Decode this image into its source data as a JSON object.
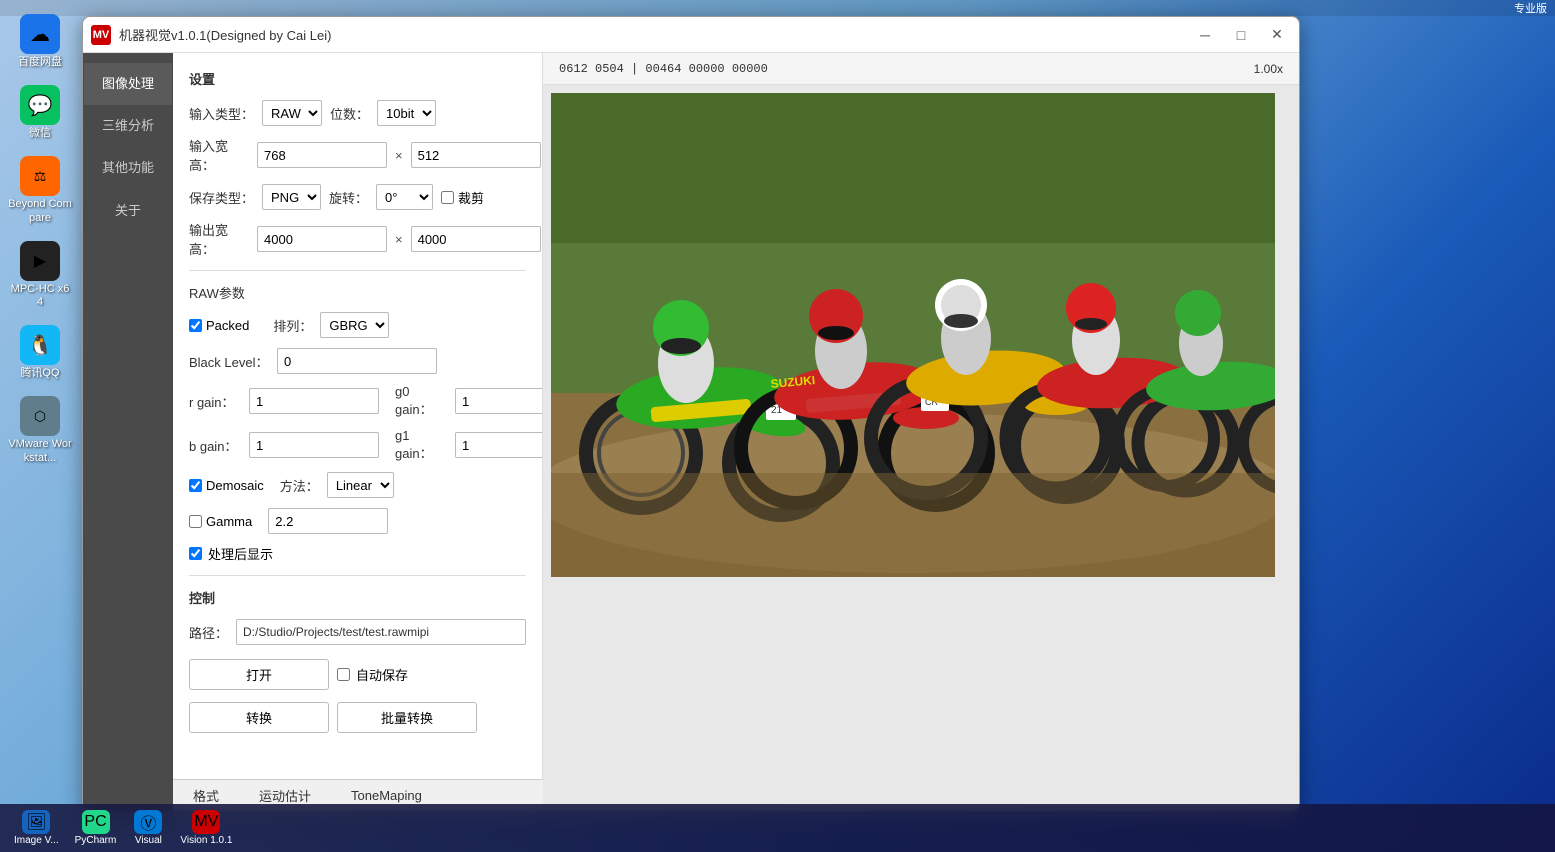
{
  "app": {
    "title": "机器视觉v1.0.1(Designed by Cai Lei)",
    "icon_label": "MV",
    "top_bar_text": "专业版"
  },
  "title_controls": {
    "minimize": "─",
    "maximize": "□",
    "close": "✕"
  },
  "image_info": {
    "coords": "0612 0504 | 00464 00000 00000",
    "zoom": "1.00x"
  },
  "sidebar": {
    "items": [
      {
        "id": "image-processing",
        "label": "图像处理",
        "active": true
      },
      {
        "id": "3d-analysis",
        "label": "三维分析",
        "active": false
      },
      {
        "id": "other-functions",
        "label": "其他功能",
        "active": false
      },
      {
        "id": "about",
        "label": "关于",
        "active": false
      }
    ]
  },
  "settings": {
    "section_title": "设置",
    "input_type_label": "输入类型：",
    "input_type_value": "RAW",
    "bit_depth_label": "位数：",
    "bit_depth_value": "10bit",
    "input_width_label": "输入宽高：",
    "input_width_value": "768",
    "input_height_value": "512",
    "save_type_label": "保存类型：",
    "save_type_value": "PNG",
    "rotate_label": "旋转：",
    "rotate_value": "0°",
    "crop_label": "裁剪",
    "output_width_label": "输出宽高：",
    "output_width_value": "4000",
    "output_height_value": "4000",
    "x_separator": "×"
  },
  "raw_params": {
    "section_title": "RAW参数",
    "packed_label": "Packed",
    "packed_checked": true,
    "arrangement_label": "排列：",
    "arrangement_value": "GBRG",
    "black_level_label": "Black Level：",
    "black_level_value": "0",
    "r_gain_label": "r gain：",
    "r_gain_value": "1",
    "g0_gain_label": "g0 gain：",
    "g0_gain_value": "1",
    "b_gain_label": "b gain：",
    "b_gain_value": "1",
    "g1_gain_label": "g1 gain：",
    "g1_gain_value": "1",
    "demosaic_label": "Demosaic",
    "demosaic_checked": true,
    "method_label": "方法：",
    "method_value": "Linear",
    "gamma_label": "Gamma",
    "gamma_checked": false,
    "gamma_value": "2.2",
    "post_display_label": "处理后显示",
    "post_display_checked": true
  },
  "control": {
    "section_title": "控制",
    "path_label": "路径：",
    "path_value": "D:/Studio/Projects/test/test.rawmipi",
    "open_button": "打开",
    "auto_save_label": "自动保存",
    "auto_save_checked": false,
    "convert_button": "转换",
    "batch_convert_button": "批量转换"
  },
  "bottom_tabs": [
    {
      "id": "format",
      "label": "格式"
    },
    {
      "id": "motion-estimation",
      "label": "运动估计"
    },
    {
      "id": "tone-mapping",
      "label": "ToneMaping"
    }
  ],
  "desktop_icons": [
    {
      "id": "baidu",
      "label": "百度网盘",
      "bg": "#1a73e8",
      "emoji": "☁"
    },
    {
      "id": "wechat",
      "label": "微信",
      "bg": "#07c160",
      "emoji": "💬"
    },
    {
      "id": "beyond",
      "label": "Beyond Compare",
      "bg": "#ff6600",
      "emoji": "⚖"
    },
    {
      "id": "mpc",
      "label": "MPC-HC x64",
      "bg": "#333",
      "emoji": "▶"
    },
    {
      "id": "qq",
      "label": "腾讯QQ",
      "bg": "#12b7f5",
      "emoji": "🐧"
    },
    {
      "id": "vmware",
      "label": "VMware Workstat...",
      "bg": "#607d8b",
      "emoji": "⬡"
    }
  ],
  "taskbar_apps": [
    {
      "id": "image-viewer",
      "label": "Image V...",
      "bg": "#1565c0",
      "emoji": "🖼"
    },
    {
      "id": "pycharm",
      "label": "PyCharm",
      "bg": "#21d789",
      "emoji": "🐍"
    },
    {
      "id": "visual",
      "label": "Visual",
      "bg": "#0078d4",
      "emoji": "Ⓥ"
    },
    {
      "id": "vision",
      "label": "Vision 1.0.1",
      "bg": "#cc0000",
      "emoji": "👁"
    }
  ],
  "colors": {
    "sidebar_bg": "#4a4a4a",
    "sidebar_active": "#5a5a5a",
    "checkbox_checked": "#0078d4"
  }
}
